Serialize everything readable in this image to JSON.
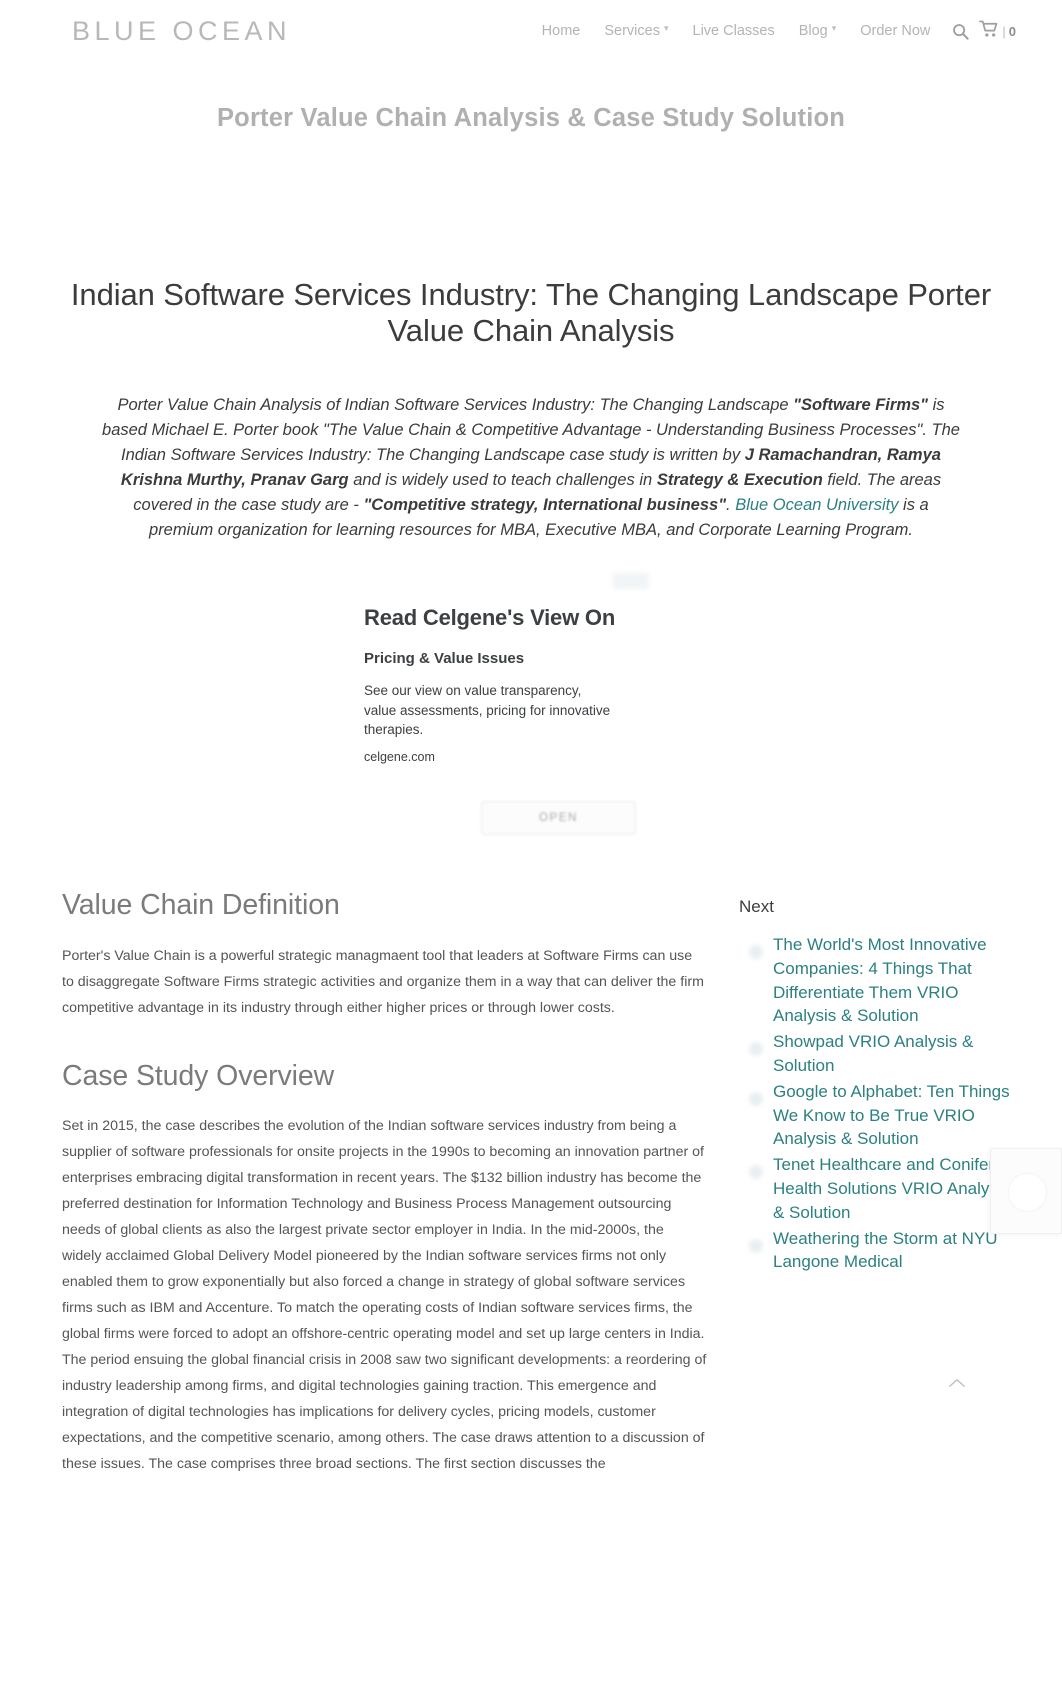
{
  "header": {
    "brand": "BLUE OCEAN",
    "nav": [
      {
        "label": "Home",
        "has_caret": false
      },
      {
        "label": "Services",
        "has_caret": true
      },
      {
        "label": "Live Classes",
        "has_caret": false
      },
      {
        "label": "Blog",
        "has_caret": true
      },
      {
        "label": "Order Now",
        "has_caret": false
      }
    ],
    "search_icon": "search-icon",
    "cart_icon": "cart-icon",
    "cart_separator": "|",
    "cart_count": "0"
  },
  "banner": {
    "title": "Porter Value Chain Analysis & Case Study Solution"
  },
  "article": {
    "title_line1": "Indian Software Services Industry: The Changing Landscape",
    "title_line2": "Porter Value Chain Analysis",
    "intro": {
      "part1": "Porter Value Chain Analysis of Indian Software Services Industry: The Changing Landscape ",
      "bold1": "\"Software Firms\"",
      "part2": " is based Michael E. Porter book \"The Value Chain & Competitive Advantage - Understanding Business Processes\". The Indian Software Services Industry: The Changing Landscape case study is written by ",
      "bold2": "J Ramachandran, Ramya Krishna Murthy, Pranav Garg",
      "part3": " and is widely used to teach challenges in ",
      "bold3": "Strategy & Execution",
      "part4": " field. The areas covered in the case study are - ",
      "bold4": "\"Competitive strategy, International business\"",
      "part5": ". ",
      "link": "Blue Ocean University",
      "part6": " is a premium organization for learning resources for MBA, Executive MBA, and Corporate Learning Program."
    }
  },
  "ad": {
    "headline": "Read Celgene's View On",
    "subhead": "Pricing & Value Issues",
    "description": "See our view on value transparency, value assessments, pricing for innovative therapies.",
    "url": "celgene.com",
    "open_label": "OPEN"
  },
  "main": {
    "section1": {
      "heading": "Value Chain Definition",
      "body": "Porter's Value Chain is a powerful strategic managmaent tool that leaders at Software Firms can use to disaggregate Software Firms strategic activities and organize them in a way that can deliver the firm competitive advantage in its industry through either higher prices or through lower costs."
    },
    "section2": {
      "heading": "Case Study Overview",
      "body": "Set in 2015, the case describes the evolution of the Indian software services industry from being a supplier of software professionals for onsite projects in the 1990s to becoming an innovation partner of enterprises embracing digital transformation in recent years. The $132 billion industry has become the preferred destination for Information Technology and Business Process Management outsourcing needs of global clients as also the largest private sector employer in India. In the mid-2000s, the widely acclaimed Global Delivery Model pioneered by the Indian software services firms not only enabled them to grow exponentially but also forced a change in strategy of global software services firms such as IBM and Accenture. To match the operating costs of Indian software services firms, the global firms were forced to adopt an offshore-centric operating model and set up large centers in India. The period ensuing the global financial crisis in 2008 saw two significant developments: a reordering of industry leadership among firms, and digital technologies gaining traction. This emergence and integration of digital technologies has implications for delivery cycles, pricing models, customer expectations, and the competitive scenario, among others. The case draws attention to a discussion of these issues. The case comprises three broad sections. The first section discusses the"
    }
  },
  "sidebar": {
    "title": "Next",
    "links": [
      "The World's Most Innovative Companies: 4 Things That Differentiate Them VRIO Analysis & Solution",
      "Showpad VRIO Analysis & Solution",
      "Google to Alphabet: Ten Things We Know to Be True VRIO Analysis & Solution",
      "Tenet Healthcare and Conifer Health Solutions VRIO Analysis & Solution",
      "Weathering the Storm at NYU Langone Medical"
    ]
  },
  "floating": {
    "back_to_top_icon": "chevron-up-icon",
    "side_widget_icon": "circle-widget-icon"
  },
  "colors": {
    "link_teal": "#2d8080",
    "brand_gray": "#b8b8b8",
    "heading_gray": "#7b7b7b",
    "body_gray": "#555555"
  }
}
